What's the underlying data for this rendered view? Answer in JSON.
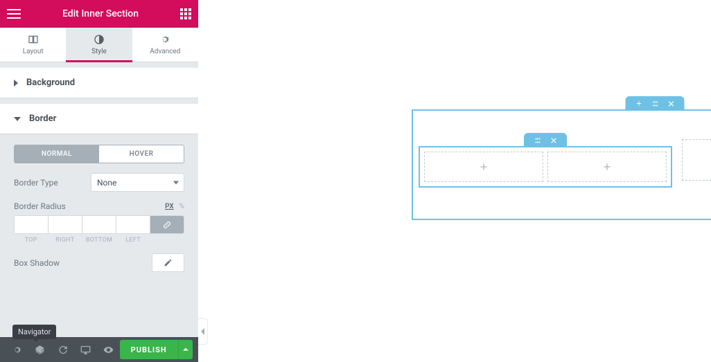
{
  "header": {
    "title": "Edit Inner Section"
  },
  "tabs": [
    {
      "label": "Layout",
      "id": "layout",
      "active": false
    },
    {
      "label": "Style",
      "id": "style",
      "active": true
    },
    {
      "label": "Advanced",
      "id": "advanced",
      "active": false
    }
  ],
  "sections": {
    "background": {
      "label": "Background",
      "open": false
    },
    "border": {
      "label": "Border",
      "open": true,
      "state_toggle": {
        "normal": "NORMAL",
        "hover": "HOVER",
        "active": "normal"
      },
      "border_type": {
        "label": "Border Type",
        "value": "None"
      },
      "border_radius": {
        "label": "Border Radius",
        "units": [
          "PX",
          "%"
        ],
        "active_unit": "PX",
        "sides": [
          "TOP",
          "RIGHT",
          "BOTTOM",
          "LEFT"
        ],
        "values": [
          "",
          "",
          "",
          ""
        ],
        "linked": true
      },
      "box_shadow": {
        "label": "Box Shadow"
      }
    }
  },
  "tooltip": "Navigator",
  "footer": {
    "publish": "PUBLISH"
  },
  "icons": {
    "burger": "menu-icon",
    "apps": "apps-icon",
    "layout": "columns-icon",
    "style": "contrast-icon",
    "advanced": "gear-icon",
    "plus": "plus-icon",
    "drag": "drag-icon",
    "close": "close-icon",
    "link": "link-icon",
    "pencil": "pencil-icon",
    "settings": "gear-icon",
    "navigator": "layers-icon",
    "history": "undo-icon",
    "responsive": "desktop-icon",
    "preview": "eye-icon",
    "caret_up": "caret-up-icon"
  }
}
